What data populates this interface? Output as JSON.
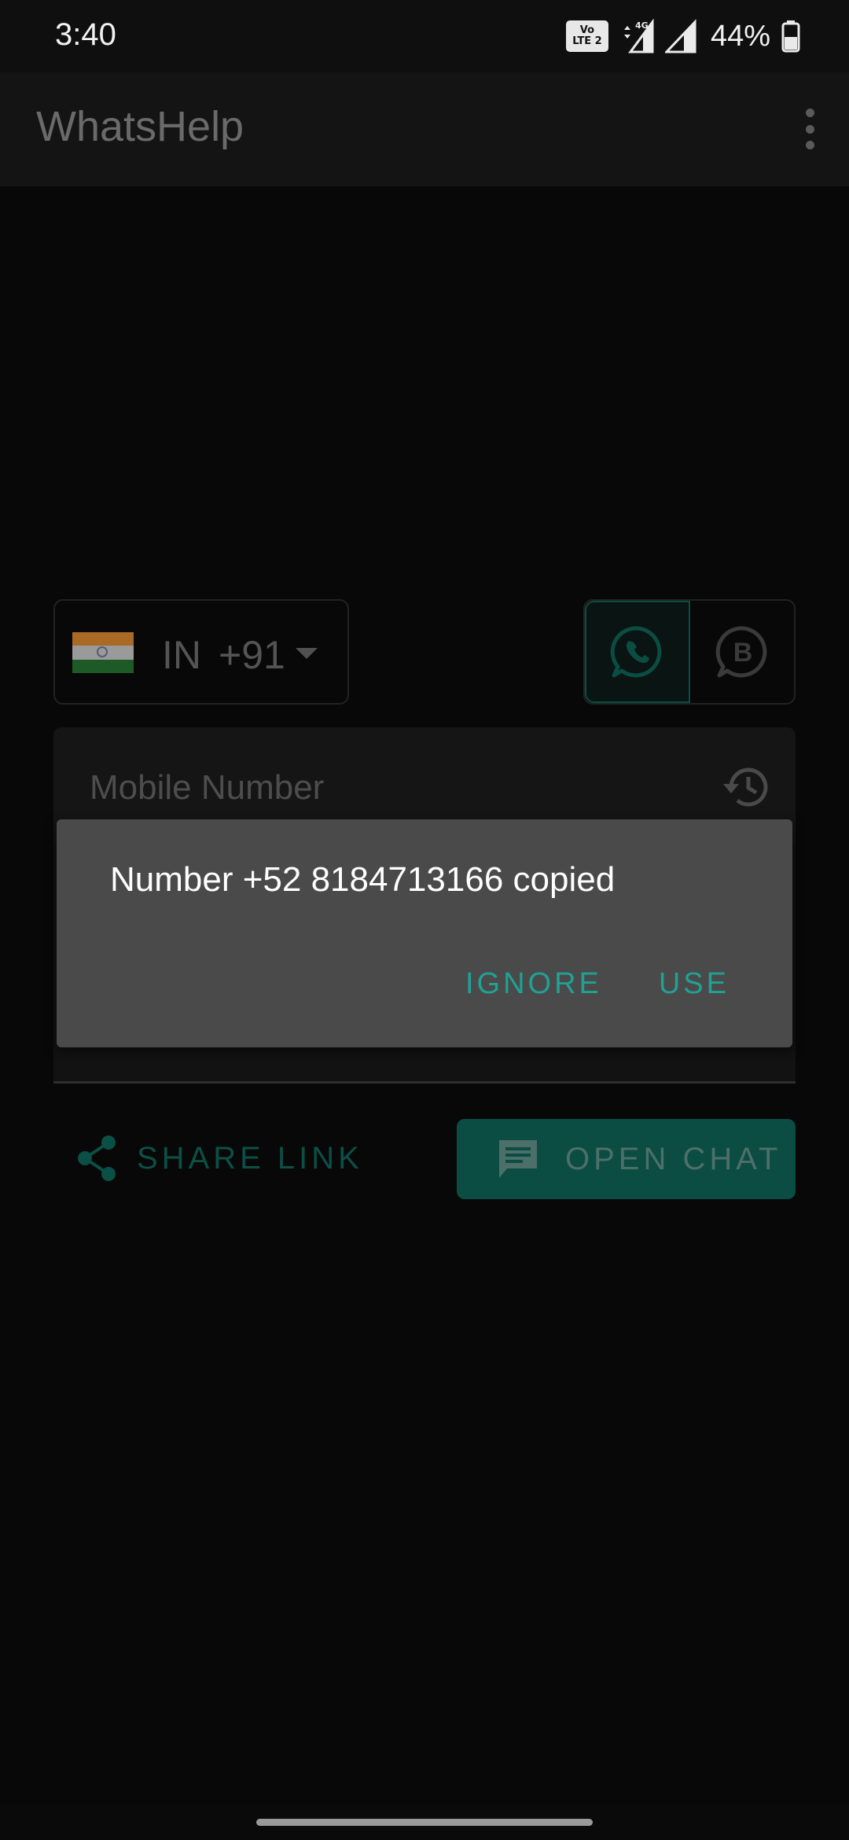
{
  "status_bar": {
    "time": "3:40",
    "volte_top": "Vo",
    "volte_bottom": "LTE 2",
    "network_type": "4G",
    "battery": "44%"
  },
  "app_bar": {
    "title": "WhatsHelp"
  },
  "country_selector": {
    "iso": "IN",
    "dial_code": "+91",
    "flag_colors": [
      "#a86a25",
      "#9a9a9a",
      "#1e5a26"
    ]
  },
  "app_toggle": {
    "selected": "whatsapp",
    "accent": "#0b4d43"
  },
  "phone_input": {
    "placeholder": "Mobile Number"
  },
  "actions": {
    "share_link": "SHARE LINK",
    "open_chat": "OPEN CHAT"
  },
  "dialog": {
    "message": "Number +52 8184713166 copied",
    "ignore": "IGNORE",
    "use": "USE",
    "accent": "#1fa294"
  }
}
